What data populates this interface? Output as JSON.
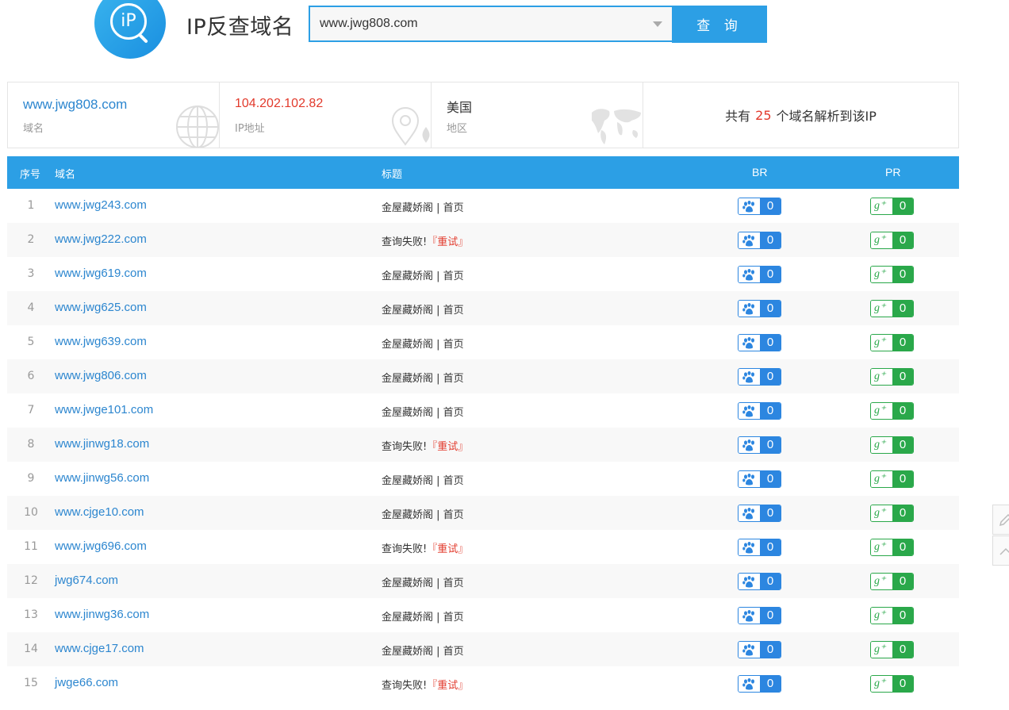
{
  "header": {
    "logo_text": "iP",
    "title": "IP反查域名",
    "search_value": "www.jwg808.com",
    "search_button": "查 询"
  },
  "info": {
    "domain_value": "www.jwg808.com",
    "domain_label": "域名",
    "ip_value": "104.202.102.82",
    "ip_label": "IP地址",
    "region_value": "美国",
    "region_label": "地区",
    "summary_prefix": "共有",
    "summary_count": "25",
    "summary_suffix": "个域名解析到该IP"
  },
  "table": {
    "headers": {
      "index": "序号",
      "domain": "域名",
      "title": "标题",
      "br": "BR",
      "pr": "PR"
    },
    "fail_text": "查询失败!",
    "retry_text": "『重试』",
    "rows": [
      {
        "index": "1",
        "domain": "www.jwg243.com",
        "title": "金屋藏娇阁 | 首页",
        "status": "ok",
        "br": "0",
        "pr": "0"
      },
      {
        "index": "2",
        "domain": "www.jwg222.com",
        "title": "",
        "status": "fail",
        "br": "0",
        "pr": "0"
      },
      {
        "index": "3",
        "domain": "www.jwg619.com",
        "title": "金屋藏娇阁 | 首页",
        "status": "ok",
        "br": "0",
        "pr": "0"
      },
      {
        "index": "4",
        "domain": "www.jwg625.com",
        "title": "金屋藏娇阁 | 首页",
        "status": "ok",
        "br": "0",
        "pr": "0"
      },
      {
        "index": "5",
        "domain": "www.jwg639.com",
        "title": "金屋藏娇阁 | 首页",
        "status": "ok",
        "br": "0",
        "pr": "0"
      },
      {
        "index": "6",
        "domain": "www.jwg806.com",
        "title": "金屋藏娇阁 | 首页",
        "status": "ok",
        "br": "0",
        "pr": "0"
      },
      {
        "index": "7",
        "domain": "www.jwge101.com",
        "title": "金屋藏娇阁 | 首页",
        "status": "ok",
        "br": "0",
        "pr": "0"
      },
      {
        "index": "8",
        "domain": "www.jinwg18.com",
        "title": "",
        "status": "fail",
        "br": "0",
        "pr": "0"
      },
      {
        "index": "9",
        "domain": "www.jinwg56.com",
        "title": "金屋藏娇阁 | 首页",
        "status": "ok",
        "br": "0",
        "pr": "0"
      },
      {
        "index": "10",
        "domain": "www.cjge10.com",
        "title": "金屋藏娇阁 | 首页",
        "status": "ok",
        "br": "0",
        "pr": "0"
      },
      {
        "index": "11",
        "domain": "www.jwg696.com",
        "title": "",
        "status": "fail",
        "br": "0",
        "pr": "0"
      },
      {
        "index": "12",
        "domain": "jwg674.com",
        "title": "金屋藏娇阁 | 首页",
        "status": "ok",
        "br": "0",
        "pr": "0"
      },
      {
        "index": "13",
        "domain": "www.jinwg36.com",
        "title": "金屋藏娇阁 | 首页",
        "status": "ok",
        "br": "0",
        "pr": "0"
      },
      {
        "index": "14",
        "domain": "www.cjge17.com",
        "title": "金屋藏娇阁 | 首页",
        "status": "ok",
        "br": "0",
        "pr": "0"
      },
      {
        "index": "15",
        "domain": "jwge66.com",
        "title": "",
        "status": "fail",
        "br": "0",
        "pr": "0"
      }
    ]
  },
  "colors": {
    "accent": "#2c9fe5",
    "link": "#2c86cf",
    "red": "#e23a2c",
    "green": "#2aa84a",
    "br_blue": "#2c86e0"
  }
}
